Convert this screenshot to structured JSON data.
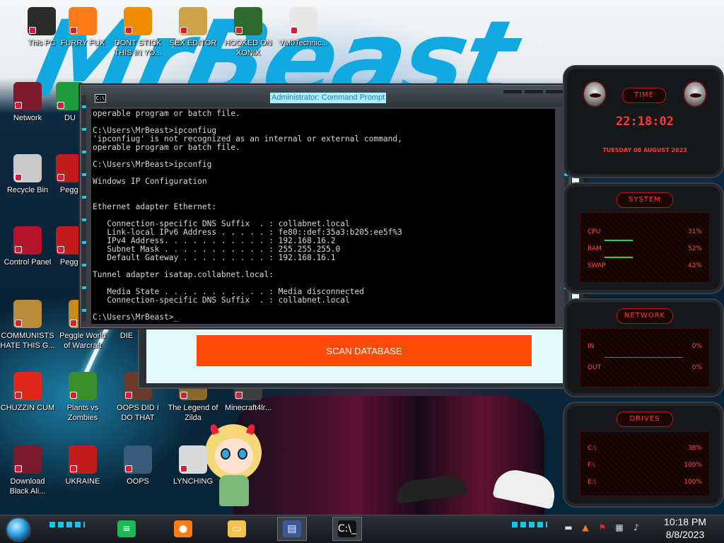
{
  "desktop_icons": [
    {
      "label": "This PC",
      "icon": "computer-icon",
      "color": "#2a2a2a"
    },
    {
      "label": "FURRY FUX",
      "icon": "firefox-icon",
      "color": "#ff7a18"
    },
    {
      "label": "DONT STICK THIS IN YO...",
      "icon": "vlc-cone-icon",
      "color": "#f08c00"
    },
    {
      "label": "SEX EDITOR",
      "icon": "hxd-icon",
      "color": "#cfa24a"
    },
    {
      "label": "HOOKED ON XONIX",
      "icon": "xonix-icon",
      "color": "#2f6b2f"
    },
    {
      "label": "VM0Technic...",
      "icon": "doctor-icon",
      "color": "#e8e8e8"
    },
    {
      "label": "Network",
      "icon": "alienware-network-icon",
      "color": "#7a1a2a"
    },
    {
      "label": "DU",
      "icon": "partial-icon",
      "color": "#1f9a3f"
    },
    {
      "label": "Recycle Bin",
      "icon": "recycle-bin-icon",
      "color": "#c9c9c9"
    },
    {
      "label": "Peggl",
      "icon": "peggle-icon",
      "color": "#c21b1b"
    },
    {
      "label": "Control Panel",
      "icon": "control-panel-icon",
      "color": "#b3132b"
    },
    {
      "label": "Peggl",
      "icon": "peggle-icon-2",
      "color": "#c21b1b"
    },
    {
      "label": "COMMUNISTS HATE THIS G...",
      "icon": "money-bag-icon",
      "color": "#b98c3c"
    },
    {
      "label": "Peggle World of Warcraft",
      "icon": "peggle-wow-icon",
      "color": "#c88a1a"
    },
    {
      "label": "DIE",
      "icon": "partial-icon-2",
      "color": "#555"
    },
    {
      "label": "CHUZZIN CUM",
      "icon": "chuzzle-icon",
      "color": "#e0271c"
    },
    {
      "label": "Plants vs Zombies",
      "icon": "pvz-icon",
      "color": "#3b8c2a"
    },
    {
      "label": "OOPS DID I DO THAT",
      "icon": "portrait-icon",
      "color": "#6b3a2a"
    },
    {
      "label": "The Legend of Zilda",
      "icon": "zelda-icon",
      "color": "#8a6a2a"
    },
    {
      "label": "Minecraft4lr...",
      "icon": "minecraft-icon",
      "color": "#3f3f3f"
    },
    {
      "label": "Download Black Ali...",
      "icon": "alienware-icon",
      "color": "#7a1a2a"
    },
    {
      "label": "UKRAINE",
      "icon": "radiation-icon",
      "color": "#c21b1b"
    },
    {
      "label": "OOPS",
      "icon": "oops-icon",
      "color": "#3a5a7a"
    },
    {
      "label": "LYNCHING",
      "icon": "lynching-icon",
      "color": "#d9d9d9"
    }
  ],
  "cmd": {
    "title": "Administrator: Command Prompt",
    "icon_text": "C:\\",
    "lines": [
      "operable program or batch file.",
      "",
      "C:\\Users\\MrBeast>ipconfiug",
      "'ipconfiug' is not recognized as an internal or external command,",
      "operable program or batch file.",
      "",
      "C:\\Users\\MrBeast>ipconfig",
      "",
      "Windows IP Configuration",
      "",
      "",
      "Ethernet adapter Ethernet:",
      "",
      "   Connection-specific DNS Suffix  . : collabnet.local",
      "   Link-local IPv6 Address . . . . . : fe80::def:35a3:b205:ee5f%3",
      "   IPv4 Address. . . . . . . . . . . : 192.168.16.2",
      "   Subnet Mask . . . . . . . . . . . : 255.255.255.0",
      "   Default Gateway . . . . . . . . . : 192.168.16.1",
      "",
      "Tunnel adapter isatap.collabnet.local:",
      "",
      "   Media State . . . . . . . . . . . : Media disconnected",
      "   Connection-specific DNS Suffix  . : collabnet.local",
      "",
      "C:\\Users\\MrBeast>_"
    ]
  },
  "scanner": {
    "button_label": "SCAN DATABASE",
    "button_color": "#ff4a0a",
    "panel_color": "#e3fbff"
  },
  "gadgets": {
    "time": {
      "header": "TIME",
      "clock": "22:18:02",
      "date": "TUESDAY 08 AUGUST 2023"
    },
    "system": {
      "header": "SYSTEM",
      "rows": [
        {
          "label": "CPU",
          "value": "31%"
        },
        {
          "label": "RAM",
          "value": "52%"
        },
        {
          "label": "SWAP",
          "value": "42%"
        }
      ]
    },
    "network": {
      "header": "NETWORK",
      "rows": [
        {
          "label": "IN",
          "value": "0%"
        },
        {
          "label": "OUT",
          "value": "0%"
        }
      ]
    },
    "drives": {
      "header": "DRIVES",
      "rows": [
        {
          "label": "C:\\",
          "value": "38%"
        },
        {
          "label": "F:\\",
          "value": "100%"
        },
        {
          "label": "E:\\",
          "value": "100%"
        }
      ]
    },
    "accent": "#ff3b2f"
  },
  "taskbar": {
    "apps": [
      {
        "name": "spotify",
        "icon": "spotify-icon",
        "glyph": "≡",
        "color": "#1db954"
      },
      {
        "name": "firefox",
        "icon": "firefox-icon",
        "glyph": "●",
        "color": "#ff7a18"
      },
      {
        "name": "file explorer",
        "icon": "folder-icon",
        "glyph": "▭",
        "color": "#f2c14e"
      },
      {
        "name": "scanner app",
        "icon": "app-window-icon",
        "glyph": "▤",
        "color": "#3b5998"
      },
      {
        "name": "command prompt",
        "icon": "cmd-icon",
        "glyph": "C:\\_",
        "color": "#111111"
      }
    ],
    "time": "10:18 PM",
    "date": "8/8/2023"
  }
}
